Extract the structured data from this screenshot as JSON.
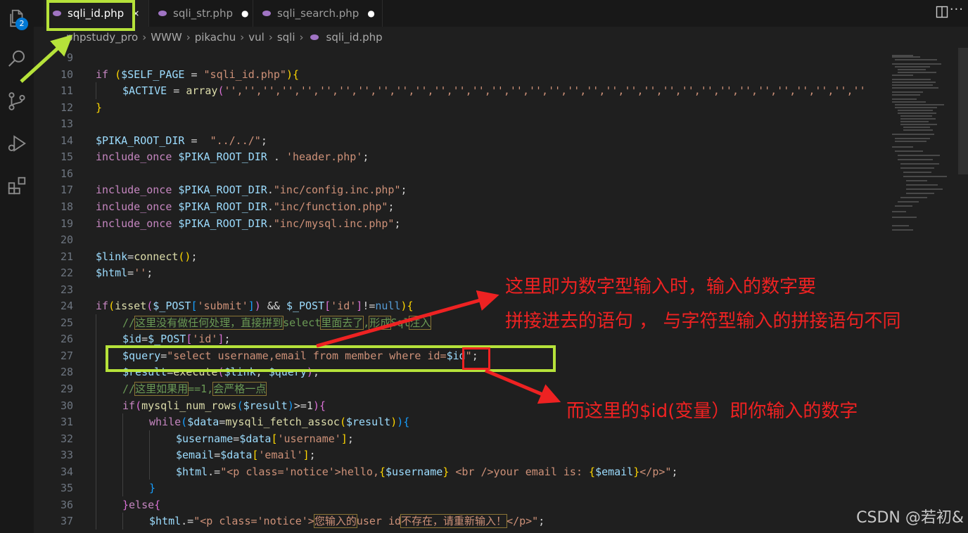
{
  "activity_bar": {
    "items": [
      {
        "name": "explorer-icon",
        "badge": "2"
      },
      {
        "name": "search-icon"
      },
      {
        "name": "source-control-icon"
      },
      {
        "name": "run-debug-icon"
      },
      {
        "name": "extensions-icon"
      }
    ]
  },
  "tabs": [
    {
      "label": "sqli_id.php",
      "active": true,
      "action": "×"
    },
    {
      "label": "sqli_str.php",
      "active": false,
      "action": "●"
    },
    {
      "label": "sqli_search.php",
      "active": false,
      "action": "●"
    }
  ],
  "breadcrumb": [
    "phpstudy_pro",
    "WWW",
    "pikachu",
    "vul",
    "sqli",
    "sqli_id.php"
  ],
  "editor": {
    "lines": [
      {
        "n": "9",
        "t": []
      },
      {
        "n": "10",
        "t": [
          [
            "kw",
            "if "
          ],
          [
            "br1",
            "("
          ],
          [
            "var",
            "$SELF_PAGE"
          ],
          [
            "op",
            " = "
          ],
          [
            "str",
            "\"sqli_id.php\""
          ],
          [
            "br1",
            ")"
          ],
          [
            "br1",
            "{"
          ]
        ]
      },
      {
        "n": "11",
        "indent": 1,
        "t": [
          [
            "var",
            "$ACTIVE"
          ],
          [
            "op",
            " = "
          ],
          [
            "fn",
            "array"
          ],
          [
            "br2",
            "("
          ],
          [
            "str",
            "'','','','','','','','','','','','','','','','','','','','','','','','','','','','','','','','','',''"
          ]
        ]
      },
      {
        "n": "12",
        "t": [
          [
            "br1",
            "}"
          ]
        ]
      },
      {
        "n": "13",
        "t": []
      },
      {
        "n": "14",
        "t": [
          [
            "var",
            "$PIKA_ROOT_DIR"
          ],
          [
            "op",
            " =  "
          ],
          [
            "str",
            "\"../../\""
          ],
          [
            "op",
            ";"
          ]
        ]
      },
      {
        "n": "15",
        "t": [
          [
            "kw",
            "include_once "
          ],
          [
            "var",
            "$PIKA_ROOT_DIR"
          ],
          [
            "op",
            " . "
          ],
          [
            "str",
            "'header.php'"
          ],
          [
            "op",
            ";"
          ]
        ]
      },
      {
        "n": "16",
        "t": []
      },
      {
        "n": "17",
        "t": [
          [
            "kw",
            "include_once "
          ],
          [
            "var",
            "$PIKA_ROOT_DIR"
          ],
          [
            "op",
            "."
          ],
          [
            "str",
            "\"inc/config.inc.php\""
          ],
          [
            "op",
            ";"
          ]
        ]
      },
      {
        "n": "18",
        "t": [
          [
            "kw",
            "include_once "
          ],
          [
            "var",
            "$PIKA_ROOT_DIR"
          ],
          [
            "op",
            "."
          ],
          [
            "str",
            "\"inc/function.php\""
          ],
          [
            "op",
            ";"
          ]
        ]
      },
      {
        "n": "19",
        "t": [
          [
            "kw",
            "include_once "
          ],
          [
            "var",
            "$PIKA_ROOT_DIR"
          ],
          [
            "op",
            "."
          ],
          [
            "str",
            "\"inc/mysql.inc.php\""
          ],
          [
            "op",
            ";"
          ]
        ]
      },
      {
        "n": "20",
        "t": []
      },
      {
        "n": "21",
        "t": [
          [
            "var",
            "$link"
          ],
          [
            "op",
            "="
          ],
          [
            "fn",
            "connect"
          ],
          [
            "br1",
            "()"
          ],
          [
            "op",
            ";"
          ]
        ]
      },
      {
        "n": "22",
        "t": [
          [
            "var",
            "$html"
          ],
          [
            "op",
            "="
          ],
          [
            "str",
            "''"
          ],
          [
            "op",
            ";"
          ]
        ]
      },
      {
        "n": "23",
        "t": []
      },
      {
        "n": "24",
        "t": [
          [
            "kw",
            "if"
          ],
          [
            "br1",
            "("
          ],
          [
            "fn",
            "isset"
          ],
          [
            "br2",
            "("
          ],
          [
            "var",
            "$_POST"
          ],
          [
            "br3",
            "["
          ],
          [
            "str",
            "'submit'"
          ],
          [
            "br3",
            "]"
          ],
          [
            "br2",
            ")"
          ],
          [
            "op",
            " && "
          ],
          [
            "var",
            "$_POST"
          ],
          [
            "br2",
            "["
          ],
          [
            "str",
            "'id'"
          ],
          [
            "br2",
            "]"
          ],
          [
            "op",
            "!="
          ],
          [
            "bl",
            "null"
          ],
          [
            "br1",
            ")"
          ],
          [
            "br1",
            "{"
          ]
        ]
      },
      {
        "n": "25",
        "indent": 1,
        "t": [
          [
            "cm",
            "//"
          ],
          [
            "cmcjk",
            "这里没有做任何处理，直接拼到"
          ],
          [
            "cm",
            "select"
          ],
          [
            "cmcjk",
            "里面去了"
          ],
          [
            "cm",
            ","
          ],
          [
            "cmcjk",
            "形成"
          ],
          [
            "cm",
            "Sql"
          ],
          [
            "cmcjk",
            "注入"
          ]
        ]
      },
      {
        "n": "26",
        "indent": 1,
        "t": [
          [
            "var",
            "$id"
          ],
          [
            "op",
            "="
          ],
          [
            "var",
            "$_POST"
          ],
          [
            "br2",
            "["
          ],
          [
            "str",
            "'id'"
          ],
          [
            "br2",
            "]"
          ],
          [
            "op",
            ";"
          ]
        ]
      },
      {
        "n": "27",
        "indent": 1,
        "t": [
          [
            "var",
            "$query"
          ],
          [
            "op",
            "="
          ],
          [
            "str",
            "\"select username,email from member where id="
          ],
          [
            "var",
            "$id"
          ],
          [
            "str",
            "\""
          ],
          [
            "op",
            ";"
          ]
        ]
      },
      {
        "n": "28",
        "indent": 1,
        "t": [
          [
            "var",
            "$result"
          ],
          [
            "op",
            "="
          ],
          [
            "fn",
            "execute"
          ],
          [
            "br2",
            "("
          ],
          [
            "var",
            "$link"
          ],
          [
            "op",
            ", "
          ],
          [
            "var",
            "$query"
          ],
          [
            "br2",
            ")"
          ],
          [
            "op",
            ";"
          ]
        ]
      },
      {
        "n": "29",
        "indent": 1,
        "t": [
          [
            "cm",
            "//"
          ],
          [
            "cmcjk",
            "这里如果用"
          ],
          [
            "cm",
            "==1,"
          ],
          [
            "cmcjk",
            "会严格一点"
          ]
        ]
      },
      {
        "n": "30",
        "indent": 1,
        "t": [
          [
            "kw",
            "if"
          ],
          [
            "br2",
            "("
          ],
          [
            "fn",
            "mysqli_num_rows"
          ],
          [
            "br3",
            "("
          ],
          [
            "var",
            "$result"
          ],
          [
            "br3",
            ")"
          ],
          [
            "op",
            ">=1"
          ],
          [
            "br2",
            ")"
          ],
          [
            "br2",
            "{"
          ]
        ]
      },
      {
        "n": "31",
        "indent": 2,
        "t": [
          [
            "kw",
            "while"
          ],
          [
            "br3",
            "("
          ],
          [
            "var",
            "$data"
          ],
          [
            "op",
            "="
          ],
          [
            "fn",
            "mysqli_fetch_assoc"
          ],
          [
            "br1",
            "("
          ],
          [
            "var",
            "$result"
          ],
          [
            "br1",
            ")"
          ],
          [
            "br3",
            ")"
          ],
          [
            "br3",
            "{"
          ]
        ]
      },
      {
        "n": "32",
        "indent": 3,
        "t": [
          [
            "var",
            "$username"
          ],
          [
            "op",
            "="
          ],
          [
            "var",
            "$data"
          ],
          [
            "br1",
            "["
          ],
          [
            "str",
            "'username'"
          ],
          [
            "br1",
            "]"
          ],
          [
            "op",
            ";"
          ]
        ]
      },
      {
        "n": "33",
        "indent": 3,
        "t": [
          [
            "var",
            "$email"
          ],
          [
            "op",
            "="
          ],
          [
            "var",
            "$data"
          ],
          [
            "br1",
            "["
          ],
          [
            "str",
            "'email'"
          ],
          [
            "br1",
            "]"
          ],
          [
            "op",
            ";"
          ]
        ]
      },
      {
        "n": "34",
        "indent": 3,
        "t": [
          [
            "var",
            "$html"
          ],
          [
            "op",
            ".="
          ],
          [
            "str",
            "\"<p class='notice'>hello,"
          ],
          [
            "br1",
            "{"
          ],
          [
            "var",
            "$username"
          ],
          [
            "br1",
            "}"
          ],
          [
            "str",
            " <br />your email is: "
          ],
          [
            "br1",
            "{"
          ],
          [
            "var",
            "$email"
          ],
          [
            "br1",
            "}"
          ],
          [
            "str",
            "</p>\""
          ],
          [
            "op",
            ";"
          ]
        ]
      },
      {
        "n": "35",
        "indent": 2,
        "t": [
          [
            "br3",
            "}"
          ]
        ]
      },
      {
        "n": "36",
        "indent": 1,
        "t": [
          [
            "br2",
            "}"
          ],
          [
            "kw",
            "else"
          ],
          [
            "br2",
            "{"
          ]
        ]
      },
      {
        "n": "37",
        "indent": 2,
        "t": [
          [
            "var",
            "$html"
          ],
          [
            "op",
            ".="
          ],
          [
            "str",
            "\"<p class='notice'>"
          ],
          [
            "strcjk",
            "您输入的"
          ],
          [
            "str",
            "user id"
          ],
          [
            "strcjk",
            "不存在，请重新输入！"
          ],
          [
            "str",
            "</p>\""
          ],
          [
            "op",
            ";"
          ]
        ]
      }
    ]
  },
  "annotations": {
    "note1_line1": "这里即为数字型输入时，输入的数字要",
    "note1_line2": "拼接进去的语句 ， 与字符型输入的拼接语句不同",
    "note2": "而这里的$id(变量）即你输入的数字",
    "green": "#b6e23a",
    "red": "#ee2222"
  },
  "watermark": "CSDN @若初&"
}
